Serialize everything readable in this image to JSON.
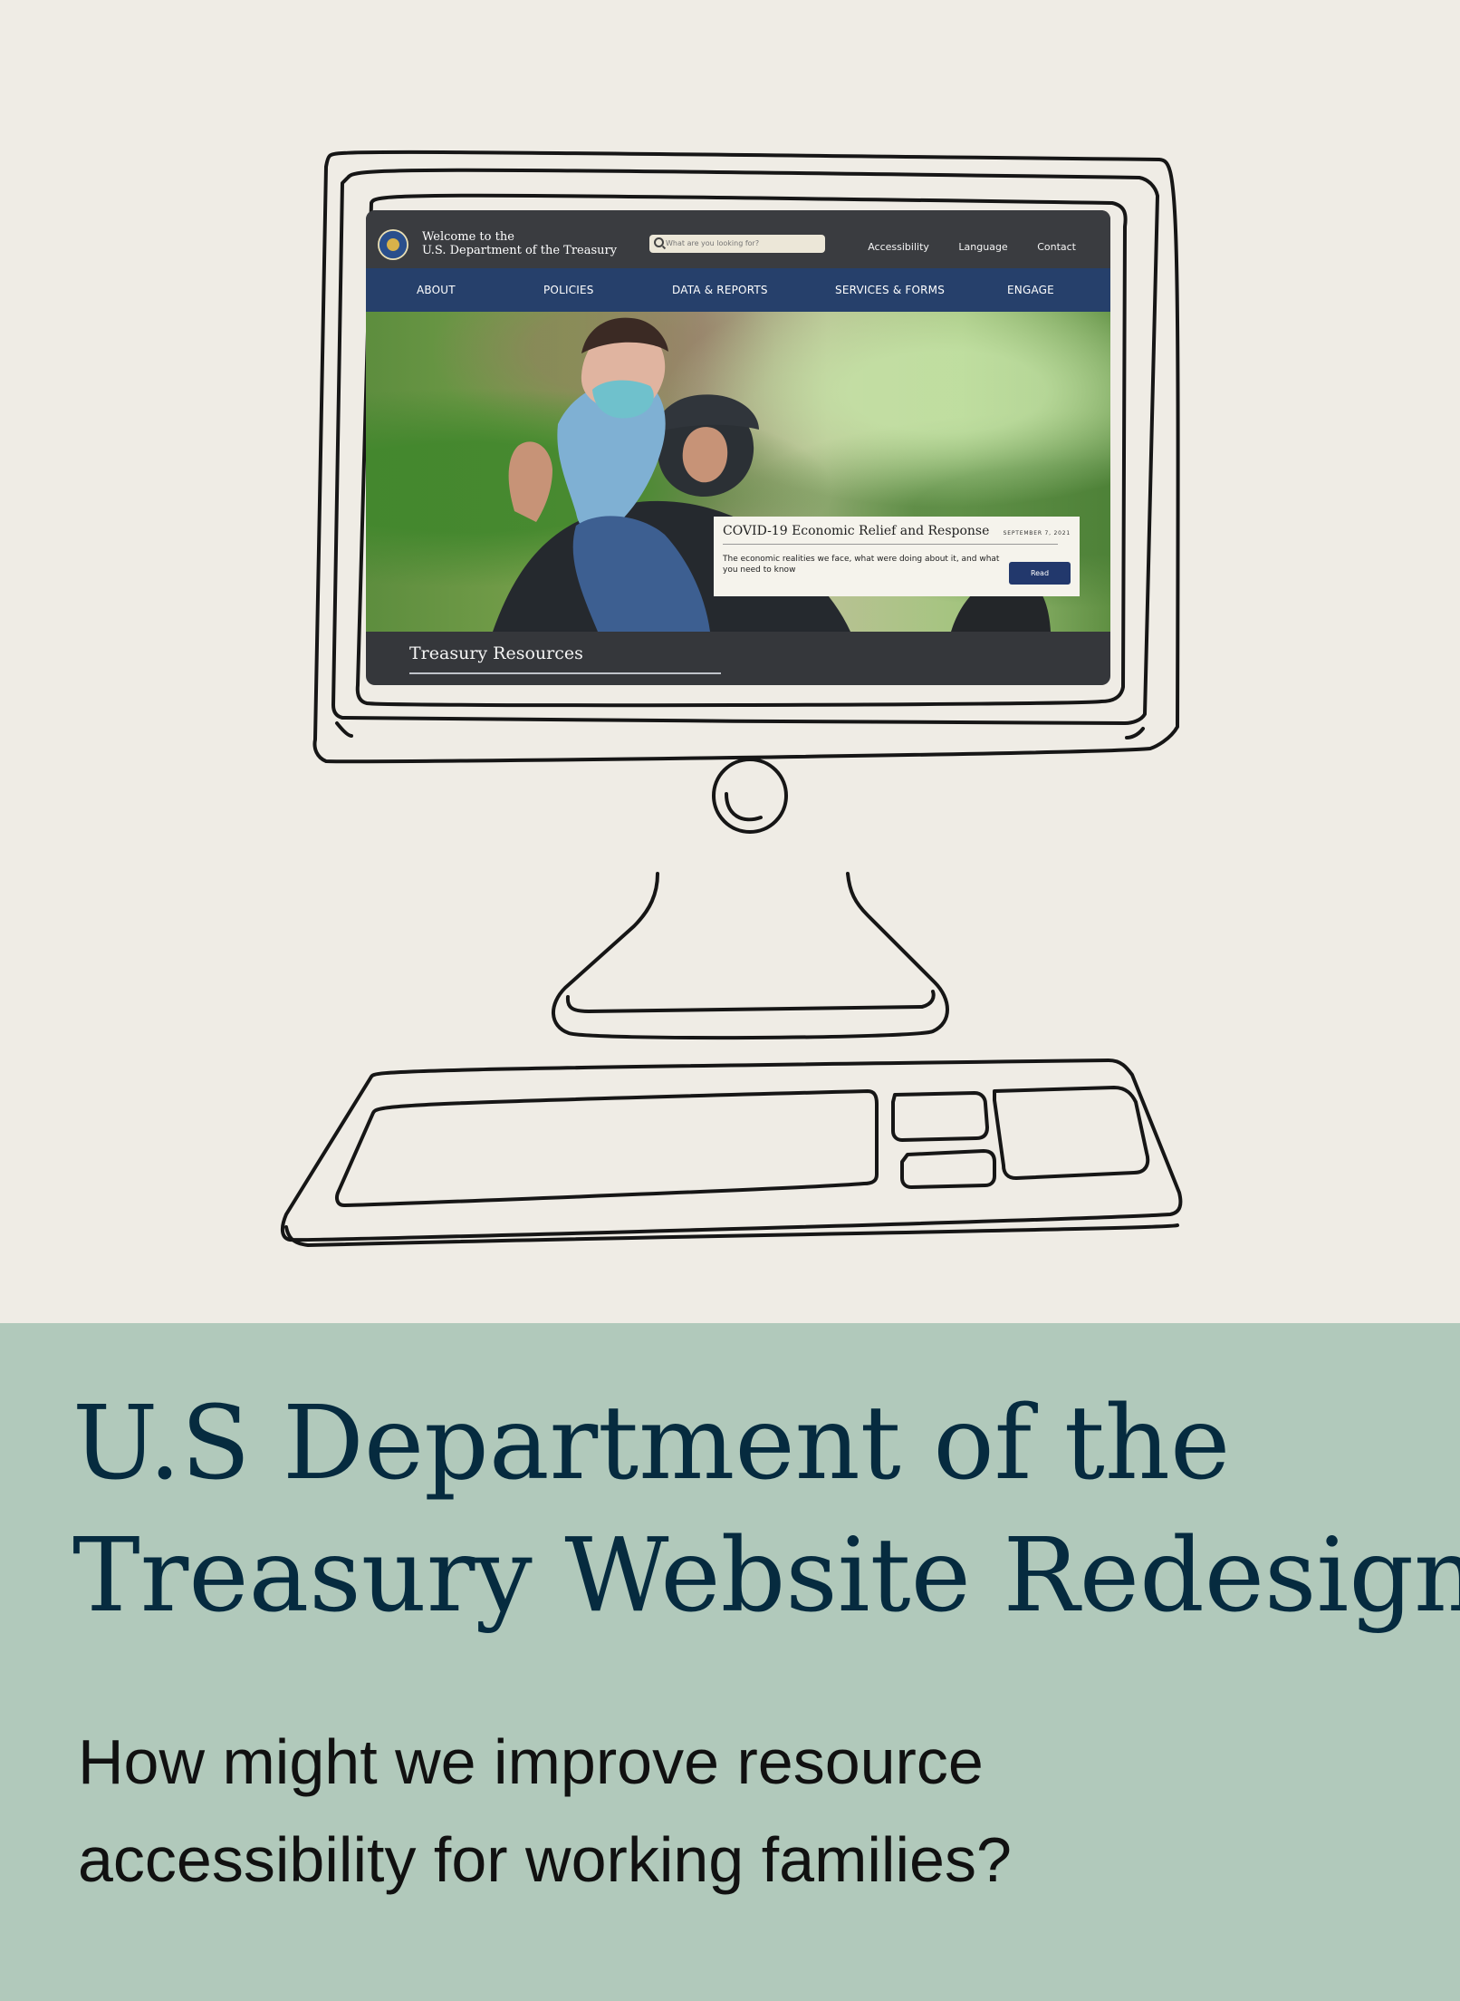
{
  "treasury_site": {
    "header": {
      "welcome_line": "Welcome to the",
      "department_name": "U.S. Department of the Treasury",
      "search_placeholder": "What are you looking for?",
      "links": [
        "Accessibility",
        "Language",
        "Contact"
      ]
    },
    "nav": {
      "items": [
        "ABOUT",
        "POLICIES",
        "DATA & REPORTS",
        "SERVICES & FORMS",
        "ENGAGE"
      ],
      "color": "#26406b"
    },
    "hero_card": {
      "title": "COVID-19 Economic Relief and Response",
      "date": "SEPTEMBER 7, 2021",
      "body": "The economic realities we face, what were doing about it, and what you need to know",
      "button": "Read"
    },
    "section_title": "Treasury Resources"
  },
  "case_study": {
    "title_line_1": "U.S Department of the",
    "title_line_2": "Treasury Website Redesign",
    "question_line_1": "How might we improve resource",
    "question_line_2": "accessibility for working families?"
  },
  "colors": {
    "sketch_background": "#efece5",
    "caption_background": "#b1c9bb",
    "title_text": "#062b3f"
  }
}
